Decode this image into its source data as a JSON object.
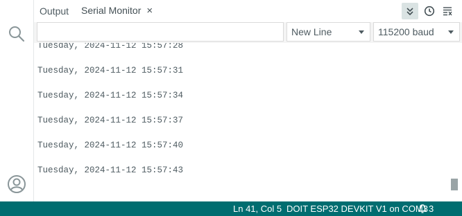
{
  "tabs": {
    "output_label": "Output",
    "serial_label": "Serial Monitor",
    "close_glyph": "×"
  },
  "toolbar_icons": [
    "autoscroll-icon",
    "timestamp-icon",
    "clear-output-icon"
  ],
  "input": {
    "value": "",
    "placeholder": ""
  },
  "line_ending": {
    "selected": "New Line"
  },
  "baud_rate": {
    "selected": "115200 baud"
  },
  "output": {
    "partial_top": "Tuesday, 2024-11-12 15:57:28",
    "lines": [
      "Tuesday, 2024-11-12 15:57:31",
      "Tuesday, 2024-11-12 15:57:34",
      "Tuesday, 2024-11-12 15:57:37",
      "Tuesday, 2024-11-12 15:57:40",
      "Tuesday, 2024-11-12 15:57:43"
    ]
  },
  "status": {
    "position": "Ln 41, Col 5",
    "board": "DOIT ESP32 DEVKIT V1 on COM3",
    "notifications": "3"
  },
  "colors": {
    "status_bar": "#006d70",
    "text": "#4e5b61",
    "autoscroll_active_bg": "#dae3e3"
  }
}
